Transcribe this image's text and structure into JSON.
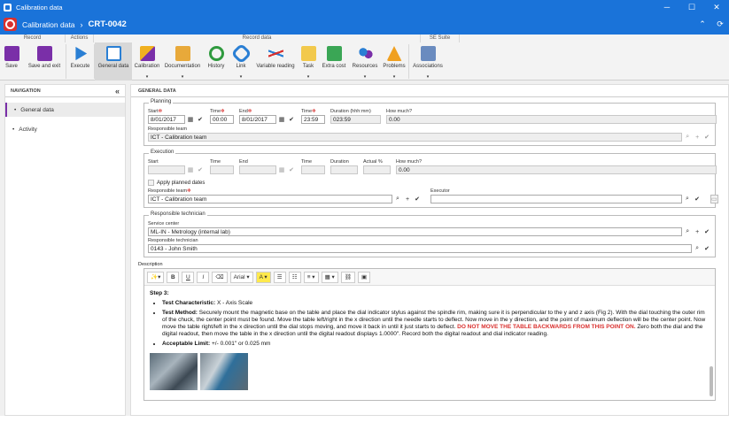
{
  "window": {
    "title": "Calibration data",
    "controls": [
      "─",
      "☐",
      "✕"
    ]
  },
  "header": {
    "module": "Calibration data",
    "record_id": "CRT-0042"
  },
  "ribbon": {
    "groups": [
      "Record",
      "Actions",
      "Record data",
      "SE Suite"
    ],
    "buttons": [
      {
        "label": "Save",
        "icon": "save-icon",
        "dropdown": false
      },
      {
        "label": "Save and exit",
        "icon": "save-exit-icon",
        "dropdown": false
      },
      {
        "label": "Execute",
        "icon": "play-icon",
        "dropdown": false
      },
      {
        "label": "General data",
        "icon": "form-icon",
        "dropdown": false,
        "active": true
      },
      {
        "label": "Calibration",
        "icon": "pencil-icon",
        "dropdown": true
      },
      {
        "label": "Documentation",
        "icon": "folder-icon",
        "dropdown": true
      },
      {
        "label": "History",
        "icon": "clock-icon",
        "dropdown": false
      },
      {
        "label": "Link",
        "icon": "link-icon",
        "dropdown": true
      },
      {
        "label": "Variable reading",
        "icon": "chart-icon",
        "dropdown": false
      },
      {
        "label": "Task",
        "icon": "task-icon",
        "dropdown": true
      },
      {
        "label": "Extra cost",
        "icon": "money-icon",
        "dropdown": false
      },
      {
        "label": "Resources",
        "icon": "people-icon",
        "dropdown": true
      },
      {
        "label": "Problems",
        "icon": "warning-icon",
        "dropdown": true
      },
      {
        "label": "Associations",
        "icon": "associations-icon",
        "dropdown": true
      }
    ]
  },
  "nav": {
    "title": "NAVIGATION",
    "collapse": "«",
    "items": [
      {
        "label": "General data",
        "selected": true
      },
      {
        "label": "Activity",
        "selected": false
      }
    ]
  },
  "content": {
    "title": "GENERAL DATA"
  },
  "planning": {
    "legend": "Planning",
    "start_label": "Start",
    "start": "8/01/2017",
    "time_label": "Time",
    "start_time": "00:00",
    "end_label": "End",
    "end": "8/01/2017",
    "end_time": "23:59",
    "duration_label": "Duration (hhh:mm)",
    "duration": "023:59",
    "howmuch_label": "How much?",
    "howmuch": "0.00",
    "team_label": "Responsible team",
    "team": "ICT - Calibration team"
  },
  "execution": {
    "legend": "Execution",
    "start_label": "Start",
    "time_label": "Time",
    "end_label": "End",
    "duration_label": "Duration",
    "actual_label": "Actual %",
    "howmuch_label": "How much?",
    "howmuch": "0.00",
    "apply_label": "Apply planned dates",
    "team_label": "Responsible team",
    "team": "ICT - Calibration team",
    "executor_label": "Executor",
    "executor": ""
  },
  "technician": {
    "legend": "Responsible technician",
    "service_label": "Service center",
    "service": "ML-IN - Metrology (internal lab)",
    "tech_label": "Responsible technician",
    "tech": "0143 - John Smith"
  },
  "description": {
    "label": "Description",
    "toolbar": {
      "magic": "✨▾",
      "bold": "B",
      "italic": "I",
      "underline": "U",
      "eraser": "⌫",
      "font": "Arial ▾",
      "color": "A ▾",
      "ul": "☰",
      "ol": "☷",
      "align": "≡ ▾",
      "table": "▦ ▾",
      "link": "⛓",
      "image": "▣"
    },
    "step": "Step 3:",
    "b1_title": "Test Characteristic:",
    "b1_text": "X - Axis Scale",
    "b2_title": "Test Method:",
    "b2_text": "Securely mount the magnetic base on the table and place the dial indicator stylus against the spindle rim, making sure it is perpendicular to the y and z axis (Fig 2). With the dial touching the outer rim of the chuck, the center point must be found. Move the table left/right in the x direction until the needle starts to deflect. Now move in the y direction, and the point of maximum deflection will be the center point. Now move the table right/left in the x direction until the dial stops moving, and move it back in until it just starts to deflect.",
    "b2_warn": "DO NOT MOVE THE TABLE BACKWARDS FROM THIS POINT ON.",
    "b2_after": "Zero both the dial and the digital readout, then move the table in the x direction until the digital readout displays 1.0000\". Record both the digital readout and dial indicator reading.",
    "b3_title": "Acceptable Limit:",
    "b3_text": "+/- 0.001\" or 0.025 mm"
  }
}
